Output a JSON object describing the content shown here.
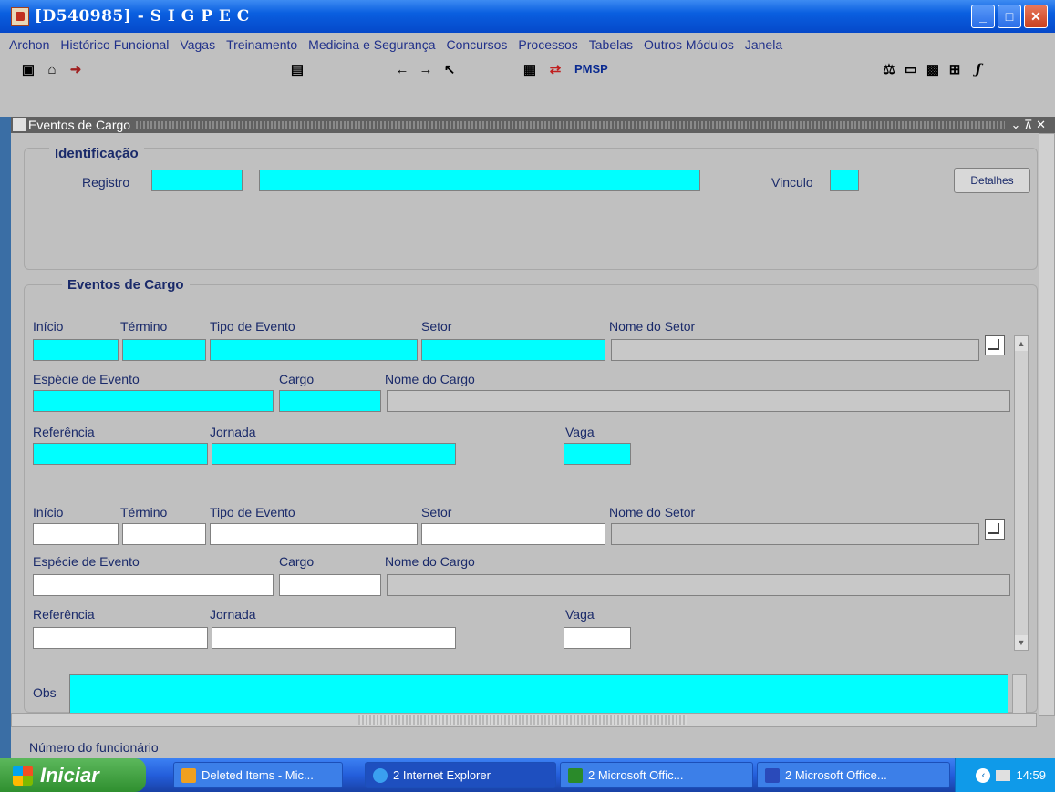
{
  "window": {
    "title": "[D540985] - S I G P E C",
    "min": "_",
    "max": "□",
    "close": "✕"
  },
  "menu": [
    {
      "label": "Archon"
    },
    {
      "label": "Histórico Funcional"
    },
    {
      "label": "Vagas"
    },
    {
      "label": "Treinamento"
    },
    {
      "label": "Medicina e Segurança"
    },
    {
      "label": "Concursos"
    },
    {
      "label": "Processos"
    },
    {
      "label": "Tabelas"
    },
    {
      "label": "Outros Módulos"
    },
    {
      "label": "Janela"
    }
  ],
  "toolbar": {
    "brand": "PMSP"
  },
  "inner_window": {
    "title": "Eventos de Cargo",
    "controls": "⌄ ⊼ ✕"
  },
  "identificacao": {
    "title": "Identificação",
    "registro_label": "Registro",
    "vinculo_label": "Vinculo",
    "detalhes_label": "Detalhes"
  },
  "eventos": {
    "title": "Eventos de Cargo",
    "labels": {
      "inicio": "Início",
      "termino": "Término",
      "tipo_evento": "Tipo de Evento",
      "setor": "Setor",
      "nome_setor": "Nome do Setor",
      "especie_evento": "Espécie de Evento",
      "cargo": "Cargo",
      "nome_cargo": "Nome do Cargo",
      "referencia": "Referência",
      "jornada": "Jornada",
      "vaga": "Vaga"
    },
    "records": [
      {
        "inicio": "",
        "termino": "",
        "tipo_evento": "",
        "setor": "",
        "nome_setor": "",
        "especie_evento": "",
        "cargo": "",
        "nome_cargo": "",
        "referencia": "",
        "jornada": "",
        "vaga": ""
      },
      {
        "inicio": "",
        "termino": "",
        "tipo_evento": "",
        "setor": "",
        "nome_setor": "",
        "especie_evento": "",
        "cargo": "",
        "nome_cargo": "",
        "referencia": "",
        "jornada": "",
        "vaga": ""
      }
    ],
    "obs_label": "Obs"
  },
  "status": {
    "text": "Número do funcionário"
  },
  "taskbar": {
    "start": "Iniciar",
    "tasks": [
      {
        "label": "Deleted Items - Mic..."
      },
      {
        "label": "2 Internet Explorer"
      },
      {
        "label": "2 Microsoft Offic..."
      },
      {
        "label": "2 Microsoft Office..."
      }
    ],
    "clock": "14:59"
  },
  "colors": {
    "active_field": "#00ffff",
    "form_bg": "#c0c0c0",
    "label": "#1a2a6a"
  }
}
